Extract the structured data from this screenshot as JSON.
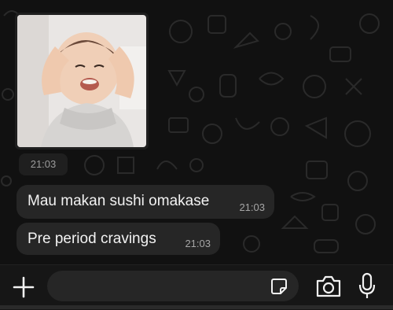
{
  "messages": {
    "image_time": "21:03",
    "items": [
      {
        "text": "Mau makan sushi omakase",
        "time": "21:03"
      },
      {
        "text": "Pre period cravings",
        "time": "21:03"
      }
    ]
  },
  "composer": {
    "placeholder": ""
  },
  "colors": {
    "chat_bg": "#111111",
    "bubble": "#262626",
    "text": "#f2f2f2",
    "time": "#a6a6a6",
    "bar": "#161616"
  },
  "icons": [
    "plus-icon",
    "sticker-icon",
    "camera-icon",
    "microphone-icon"
  ]
}
